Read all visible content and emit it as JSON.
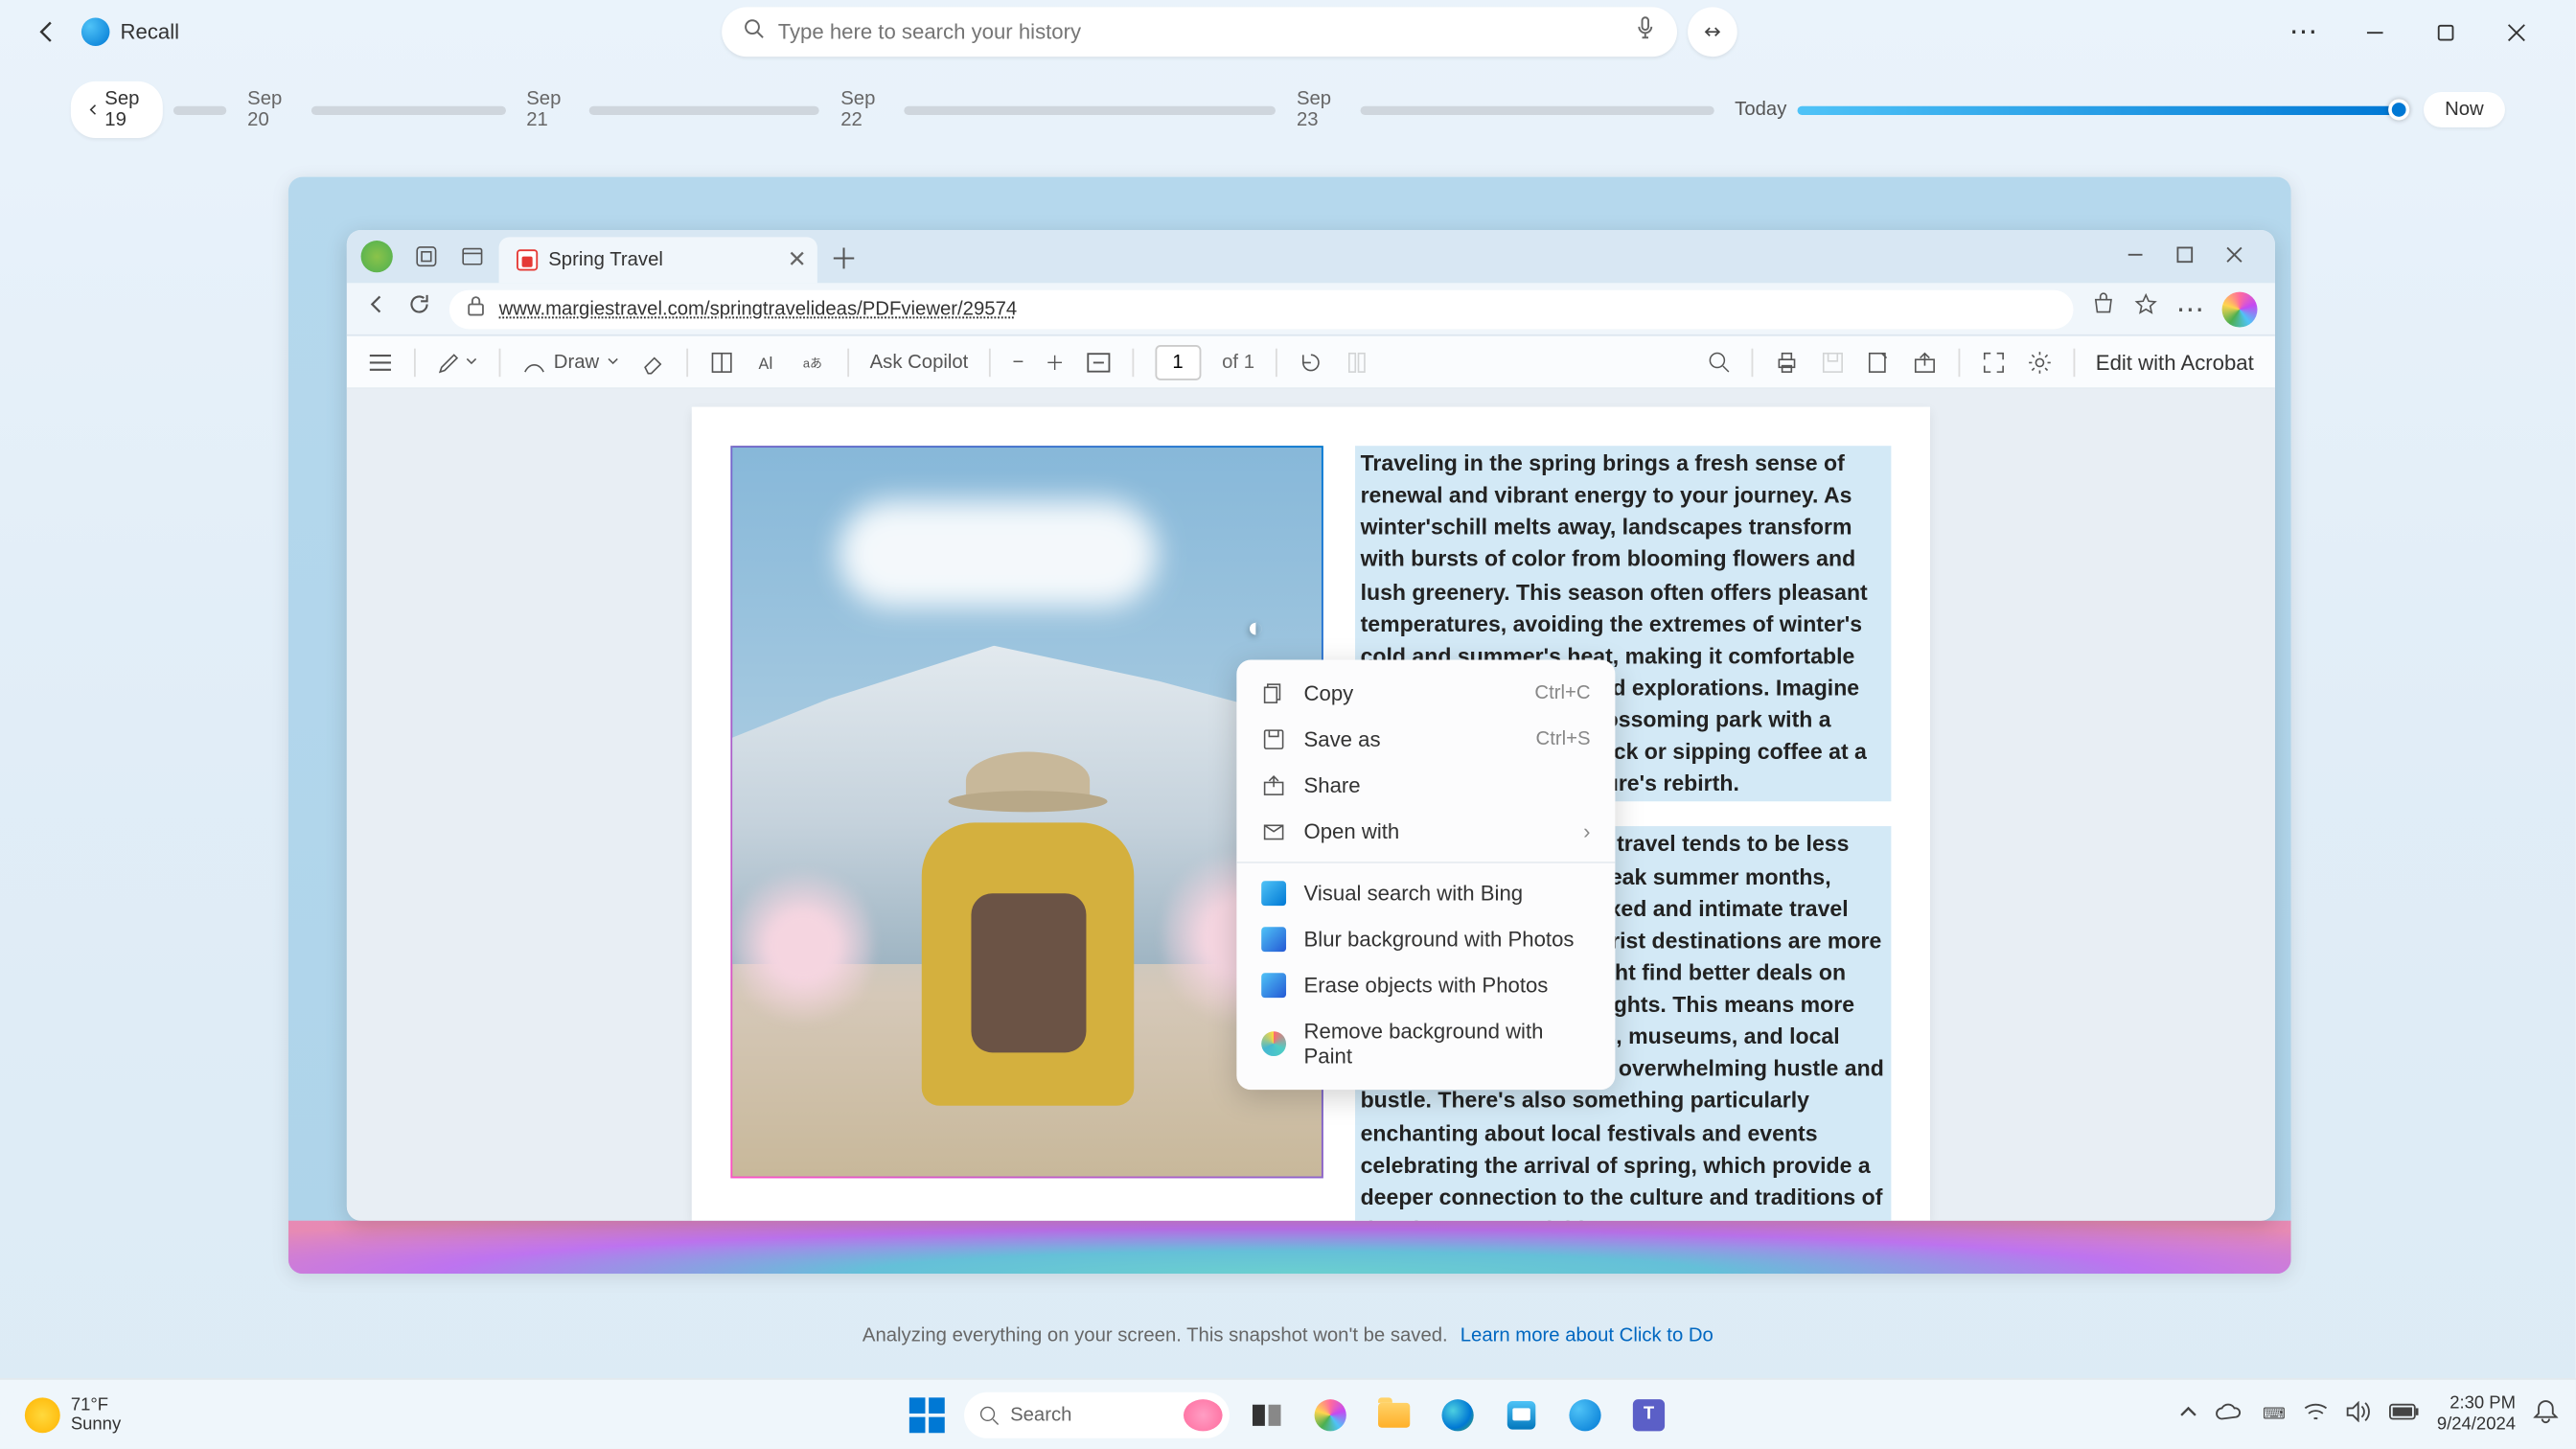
{
  "app": {
    "name": "Recall"
  },
  "search": {
    "placeholder": "Type here to search your history"
  },
  "timeline": {
    "start": "Sep 19",
    "dates": [
      "Sep 20",
      "Sep 21",
      "Sep 22",
      "Sep 23"
    ],
    "today": "Today",
    "now": "Now"
  },
  "browser": {
    "tab": "Spring Travel",
    "url": "www.margiestravel.com/springtravelideas/PDFviewer/29574"
  },
  "pdf_toolbar": {
    "draw": "Draw",
    "copilot": "Ask Copilot",
    "page": "1",
    "page_of": "of 1",
    "acrobat": "Edit with Acrobat"
  },
  "document": {
    "para1": "Traveling in the spring brings a fresh sense of renewal and vibrant energy to your journey. As winter'schill melts away, landscapes transform with bursts of color from blooming flowers and lush greenery. This season often offers pleasant temperatures, avoiding the extremes of winter's cold and summer's heat, making it comfortable for outdoor activities and explorations. Imagine wandering through a blossoming park with a gentle breeze at your back or sipping coffee at a café surrounded by nature's rebirth.",
    "para2": "Additionally, springtime travel tends to be less crowded compared to peak summer months, allowing for a more relaxed and intimate travel experience. Popular tourist destinations are more accessible, and you might find better deals on accommodations and flights. This means more time to enjoy attractions, museums, and local experiences without the overwhelming hustle and bustle. There's also something particularly enchanting about local festivals and events celebrating the arrival of spring, which provide a deeper connection to the culture and traditions of the place you're visiting."
  },
  "context_menu": {
    "copy": {
      "label": "Copy",
      "shortcut": "Ctrl+C"
    },
    "save": {
      "label": "Save as",
      "shortcut": "Ctrl+S"
    },
    "share": "Share",
    "open_with": "Open with",
    "bing": "Visual search with Bing",
    "blur": "Blur background with Photos",
    "erase": "Erase objects with Photos",
    "paint": "Remove background with Paint"
  },
  "status": {
    "text": "Analyzing everything on your screen. This snapshot won't be saved.",
    "link": "Learn more about Click to Do"
  },
  "weather": {
    "temp": "71°F",
    "cond": "Sunny"
  },
  "tb_search": {
    "placeholder": "Search"
  },
  "clock": {
    "time": "2:30 PM",
    "date": "9/24/2024"
  }
}
